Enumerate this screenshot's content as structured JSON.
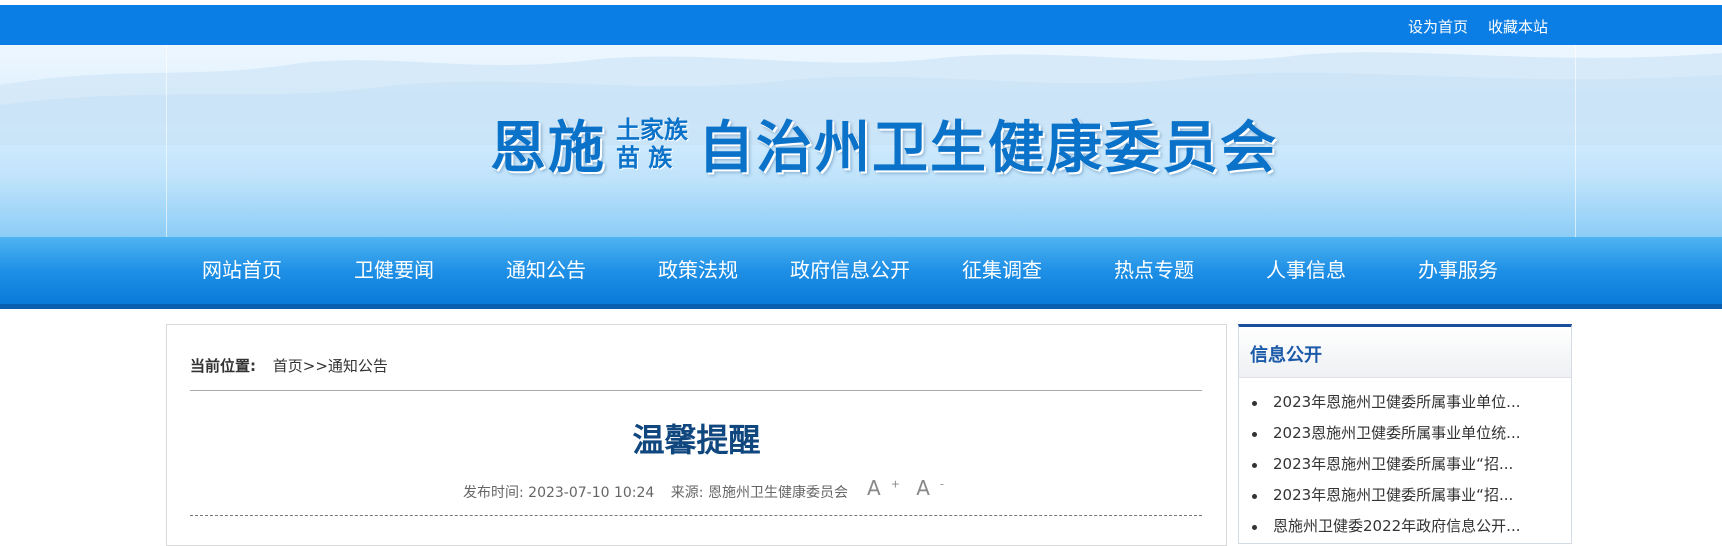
{
  "topbar": {
    "set_home": "设为首页",
    "bookmark": "收藏本站",
    "color": "#0a7ee4"
  },
  "banner": {
    "title_part1": "恩施",
    "title_small_1": "土家族",
    "title_small_2": "苗 族",
    "title_part2": "自治州卫生健康委员会"
  },
  "nav": {
    "items": [
      "网站首页",
      "卫健要闻",
      "通知公告",
      "政策法规",
      "政府信息公开",
      "征集调查",
      "热点专题",
      "人事信息",
      "办事服务"
    ]
  },
  "breadcrumb": {
    "label": "当前位置:",
    "path": "首页>>通知公告"
  },
  "article": {
    "title": "温馨提醒",
    "publish_time": "发布时间: 2023-07-10 10:24",
    "source": "来源: 恩施州卫生健康委员会",
    "font_increase": "A",
    "font_increase_sup": "+",
    "font_decrease": "A",
    "font_decrease_sup": "-"
  },
  "sidebar": {
    "heading": "信息公开",
    "items": [
      "2023年恩施州卫健委所属事业单位...",
      "2023恩施州卫健委所属事业单位统...",
      "2023年恩施州卫健委所属事业“招...",
      "2023年恩施州卫健委所属事业“招...",
      "恩施州卫健委2022年政府信息公开..."
    ]
  }
}
